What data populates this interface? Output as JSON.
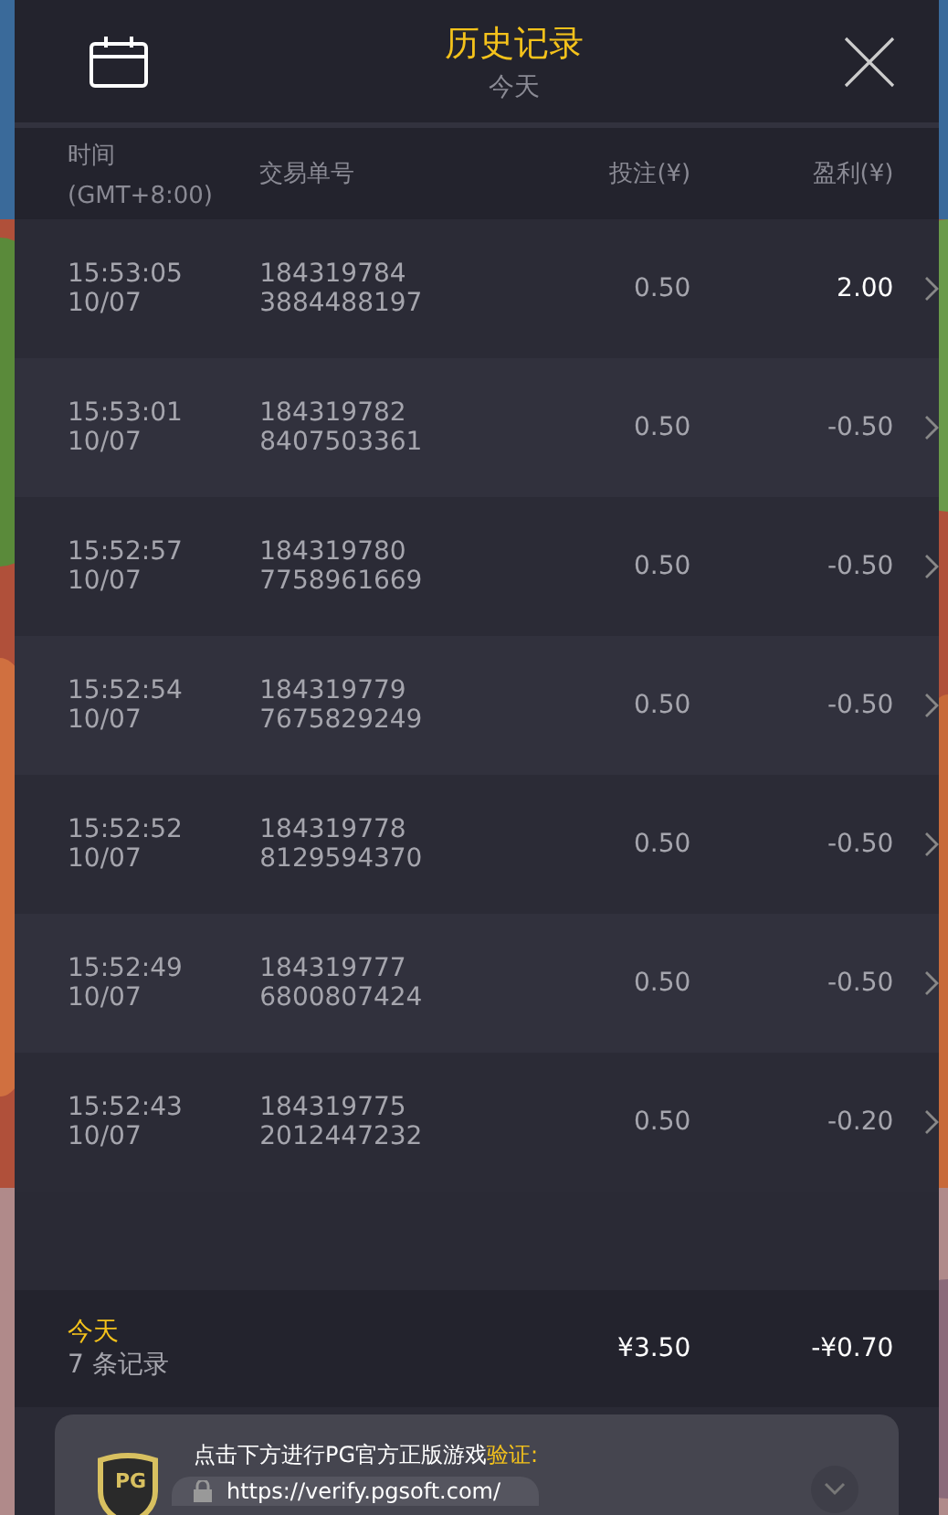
{
  "header": {
    "title": "历史记录",
    "subtitle": "今天"
  },
  "columns": [
    {
      "label": "时间",
      "sub": "(GMT+8:00)"
    },
    {
      "label": "交易单号"
    },
    {
      "label": "投注(¥)"
    },
    {
      "label": "盈利(¥)"
    }
  ],
  "rows": [
    {
      "time": "15:53:05",
      "date": "10/07",
      "order_1": "184319784",
      "order_2": "3884488197",
      "bet": "0.50",
      "profit": "2.00",
      "win": true
    },
    {
      "time": "15:53:01",
      "date": "10/07",
      "order_1": "184319782",
      "order_2": "8407503361",
      "bet": "0.50",
      "profit": "-0.50",
      "win": false
    },
    {
      "time": "15:52:57",
      "date": "10/07",
      "order_1": "184319780",
      "order_2": "7758961669",
      "bet": "0.50",
      "profit": "-0.50",
      "win": false
    },
    {
      "time": "15:52:54",
      "date": "10/07",
      "order_1": "184319779",
      "order_2": "7675829249",
      "bet": "0.50",
      "profit": "-0.50",
      "win": false
    },
    {
      "time": "15:52:52",
      "date": "10/07",
      "order_1": "184319778",
      "order_2": "8129594370",
      "bet": "0.50",
      "profit": "-0.50",
      "win": false
    },
    {
      "time": "15:52:49",
      "date": "10/07",
      "order_1": "184319777",
      "order_2": "6800807424",
      "bet": "0.50",
      "profit": "-0.50",
      "win": false
    },
    {
      "time": "15:52:43",
      "date": "10/07",
      "order_1": "184319775",
      "order_2": "2012447232",
      "bet": "0.50",
      "profit": "-0.20",
      "win": false
    }
  ],
  "summary": {
    "period": "今天",
    "count": "7 条记录",
    "total_bet": "¥3.50",
    "total_profit": "-¥0.70"
  },
  "notice": {
    "badge": "PG",
    "text": "点击下方进行PG官方正版游戏",
    "highlight": "验证:",
    "url": "https://verify.pgsoft.com/"
  }
}
